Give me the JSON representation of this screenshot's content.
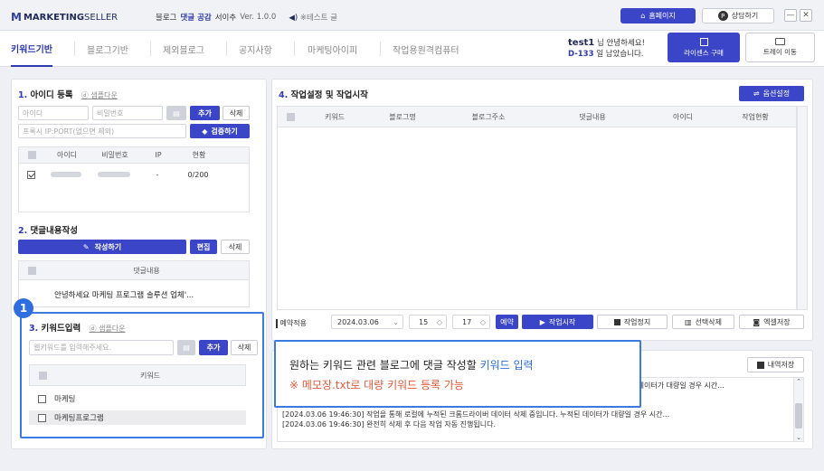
{
  "app": {
    "logo_prefix": "M",
    "logo_marketing": "MARKETING",
    "logo_seller": "SELLER",
    "subtitle_pre": "블로그",
    "subtitle_blue": "댓글 공감",
    "subtitle_post": "서이추",
    "version": "Ver. 1.0.0",
    "test_label": "※테스트 글"
  },
  "header_buttons": {
    "home": "홈페이지",
    "consult": "상담하기",
    "minimize": "—",
    "close": "✕"
  },
  "tabs": [
    {
      "label": "키워드기반"
    },
    {
      "label": "블로그기반"
    },
    {
      "label": "제외블로그"
    },
    {
      "label": "공지사항"
    },
    {
      "label": "마케팅아이피"
    },
    {
      "label": "작업용원격컴퓨터"
    }
  ],
  "user": {
    "name": "test1",
    "greeting": "님 안녕하세요!",
    "dday": "D-133",
    "remaining": "일 남았습니다."
  },
  "license_button": "라이센스 구매",
  "tray_button": "트레이 이동",
  "section1": {
    "num": "1.",
    "title": "아이디 등록",
    "sample": "샘플다운",
    "id_placeholder": "아이디",
    "pw_placeholder": "비밀번호",
    "add": "추가",
    "delete": "삭제",
    "proxy_placeholder": "프록시 IP:PORT(없으면 제외)",
    "verify": "검증하기",
    "headers": [
      "아이디",
      "비밀번호",
      "IP",
      "현황"
    ],
    "row": {
      "ip": "-",
      "status": "0/200"
    }
  },
  "section2": {
    "num": "2.",
    "title": "댓글내용작성",
    "write": "작성하기",
    "edit": "편집",
    "delete": "삭제",
    "header": "댓글내용",
    "row": "안녕하세요 마케팅 프로그램 솔루션 업체'..."
  },
  "section3": {
    "num": "3.",
    "title": "키워드입력",
    "sample": "샘플다운",
    "placeholder": "웹키워드를 입력해주세요.",
    "add": "추가",
    "delete": "삭제",
    "header": "키워드",
    "rows": [
      "마케팅",
      "마케팅프로그램"
    ]
  },
  "badge": "1",
  "section4": {
    "num": "4.",
    "title": "작업설정 및 작업시작",
    "options": "옵션설정",
    "headers": [
      "키워드",
      "블로그명",
      "블로그주소",
      "댓글내용",
      "아이디",
      "작업현황"
    ]
  },
  "controls": {
    "reserve": "예약적용",
    "date": "2024.03.06",
    "hour": "15",
    "minute": "17",
    "reserve_btn": "예약",
    "start": "작업시작",
    "stop": "작업정지",
    "delete_sel": "선택삭제",
    "excel": "엑셀저장"
  },
  "log": {
    "history": "내역저장",
    "lines": [
      "누적된 데이터가 대량일 경우 시간...",
      "[2024.03.06 19:46:30]  작업을 통해 로컬에 누적된 크롬드라이버 데이터 삭제 중입니다. 누적된 데이터가 대량일 경우 시간...",
      "[2024.03.06 19:46:30]  완전히 삭제 후 다음 작업 자동 진행됩니다."
    ]
  },
  "callout": {
    "line1_pre": "원하는 키워드 관련 블로그에 댓글 작성할 ",
    "line1_blue": "키워드 입력",
    "line2": "※ 메모장.txt로 대량 키워드 등록 가능"
  }
}
